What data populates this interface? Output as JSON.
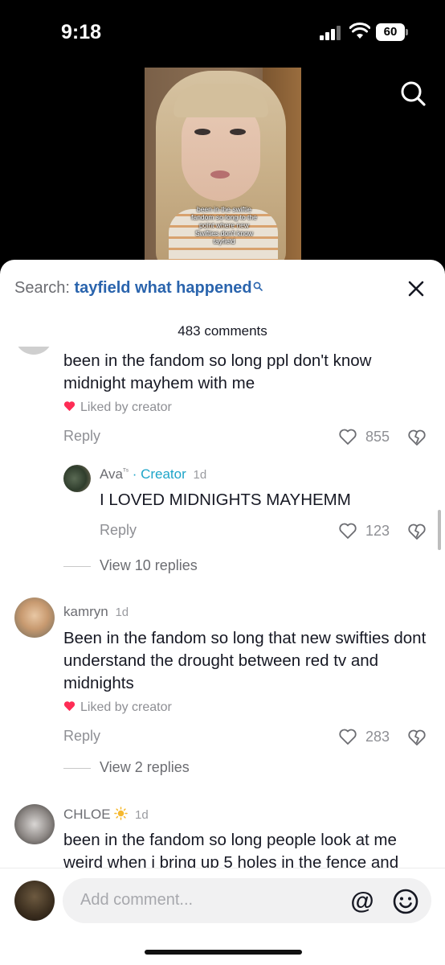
{
  "status_bar": {
    "time": "9:18",
    "battery": "60"
  },
  "video": {
    "caption": "been in the swiftie fandom so long to the point where new Swifties don't know tayfield"
  },
  "sheet": {
    "search_prefix": "Search: ",
    "search_query": "tayfield what happened",
    "comment_count": "483 comments"
  },
  "comments": [
    {
      "text": "been in the fandom so long ppl don't know midnight mayhem with me",
      "liked_by_creator": "Liked by creator",
      "reply_label": "Reply",
      "likes": "855",
      "reply": {
        "name": "Ava",
        "name_suffix": "ᵀˢ",
        "creator_label": "· Creator",
        "time": "1d",
        "text": "I LOVED MIDNIGHTS MAYHEMM",
        "reply_label": "Reply",
        "likes": "123"
      },
      "view_replies": "View 10 replies"
    },
    {
      "name": "kamryn",
      "time": "1d",
      "text": "Been in the fandom so long that new swifties dont understand the drought between red tv and midnights",
      "liked_by_creator": "Liked by creator",
      "reply_label": "Reply",
      "likes": "283",
      "view_replies": "View 2 replies"
    },
    {
      "name": "CHLOE",
      "time": "1d",
      "text": "been in the fandom so long people look at me weird when i bring up 5 holes in the fence and"
    }
  ],
  "input": {
    "placeholder": "Add comment..."
  },
  "icons": {
    "search": "search-icon",
    "close": "close-icon",
    "heart": "heart-icon",
    "dislike": "dislike-icon",
    "mention": "at-icon",
    "emoji": "emoji-icon",
    "sun": "sun-emoji-icon"
  },
  "colors": {
    "accent_blue": "#2a64ad",
    "creator_teal": "#1ea5c9",
    "liked_red": "#fe2c55"
  }
}
